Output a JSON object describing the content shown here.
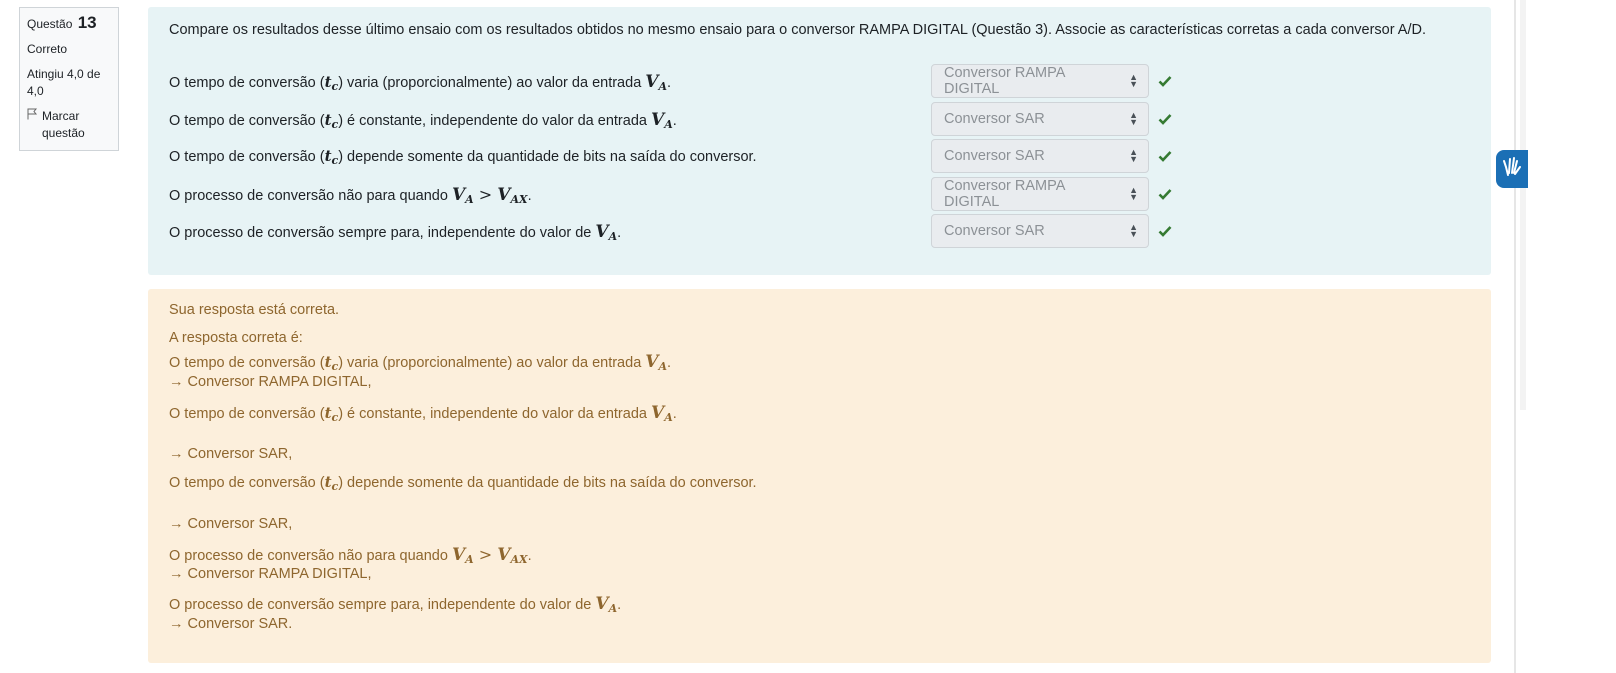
{
  "info": {
    "question_label": "Questão",
    "question_number": "13",
    "status": "Correto",
    "grade": "Atingiu 4,0 de 4,0",
    "flag_label": "Marcar questão"
  },
  "question": {
    "text": "Compare os resultados desse último ensaio com os resultados obtidos no mesmo ensaio para o conversor RAMPA DIGITAL (Questão 3). Associe as características corretas a cada conversor A/D.",
    "rows": [
      {
        "pre": "O tempo de conversão (",
        "t": "t",
        "t_sub": "c",
        "post": ") varia (proporcionalmente) ao valor da entrada ",
        "v": "V",
        "v_sub": "A",
        "v2": "",
        "v2_sub": "",
        "op": "",
        "end": ".",
        "selected": "Conversor RAMPA DIGITAL"
      },
      {
        "pre": "O tempo de conversão (",
        "t": "t",
        "t_sub": "c",
        "post": ") é constante, independente do valor da entrada ",
        "v": "V",
        "v_sub": "A",
        "v2": "",
        "v2_sub": "",
        "op": "",
        "end": ".",
        "selected": "Conversor SAR"
      },
      {
        "pre": "O tempo de conversão (",
        "t": "t",
        "t_sub": "c",
        "post": ") depende somente da quantidade de bits na saída do conversor.",
        "v": "",
        "v_sub": "",
        "v2": "",
        "v2_sub": "",
        "op": "",
        "end": "",
        "selected": "Conversor SAR"
      },
      {
        "pre": "O processo de conversão não para quando ",
        "t": "",
        "t_sub": "",
        "post": "",
        "v": "V",
        "v_sub": "A",
        "op": " > ",
        "v2": "V",
        "v2_sub": "AX",
        "end": ".",
        "selected": "Conversor RAMPA DIGITAL"
      },
      {
        "pre": "O processo de conversão sempre para, independente do valor de ",
        "t": "",
        "t_sub": "",
        "post": "",
        "v": "V",
        "v_sub": "A",
        "v2": "",
        "v2_sub": "",
        "op": "",
        "end": ".",
        "selected": "Conversor SAR"
      }
    ]
  },
  "feedback": {
    "result": "Sua resposta está correta.",
    "correct_intro": "A resposta correta é:",
    "answers": [
      "→ Conversor RAMPA DIGITAL,",
      "→ Conversor SAR,",
      "→ Conversor SAR,",
      "→ Conversor RAMPA DIGITAL,",
      "→ Conversor SAR."
    ]
  },
  "colors": {
    "question_bg": "#e7f3f5",
    "feedback_bg": "#fcefdc",
    "feedback_text": "#8e662e",
    "check_green": "#357a32",
    "accessibility_blue": "#1b6fb5"
  },
  "icons": [
    "flag-icon",
    "check-icon",
    "select-caret-icon",
    "sign-language-icon"
  ]
}
